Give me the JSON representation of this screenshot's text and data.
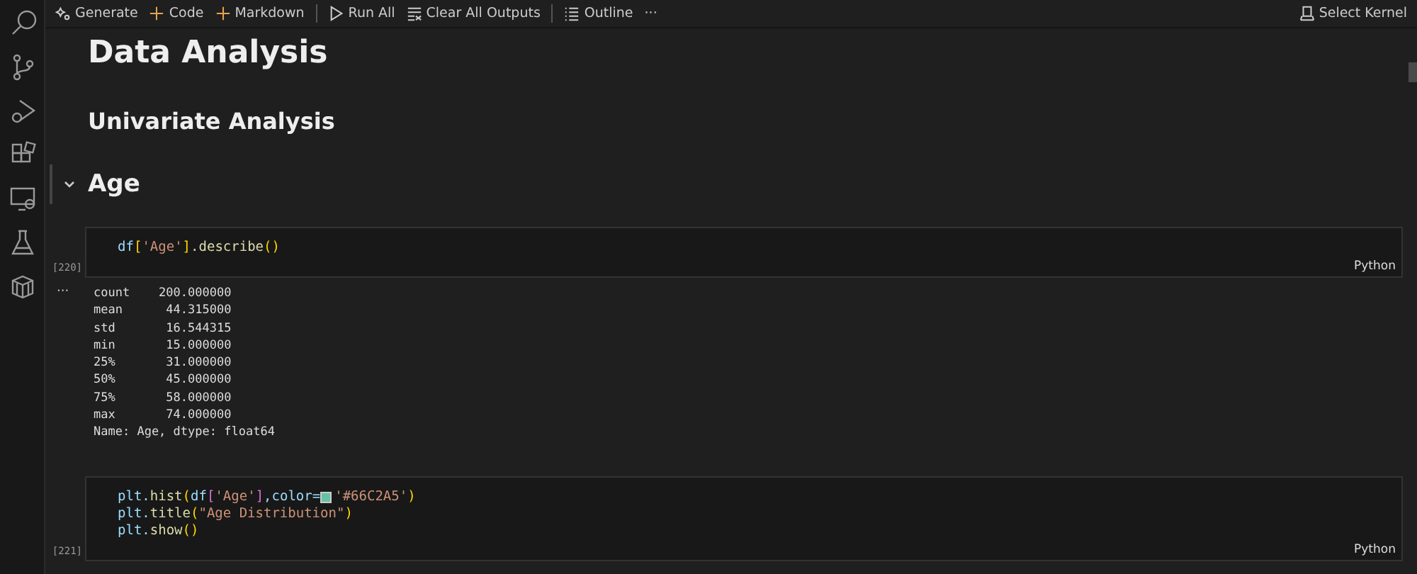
{
  "toolbar": {
    "items": [
      {
        "kind": "button",
        "label": "Generate"
      },
      {
        "kind": "button",
        "label": "Code"
      },
      {
        "kind": "button",
        "label": "Markdown"
      },
      {
        "kind": "separator"
      },
      {
        "kind": "button",
        "label": "Run All"
      },
      {
        "kind": "button",
        "label": "Clear All Outputs"
      },
      {
        "kind": "separator"
      },
      {
        "kind": "button",
        "label": "Outline"
      },
      {
        "kind": "more",
        "label": "···"
      }
    ],
    "kernel": "Select Kernel"
  },
  "cells": [
    {
      "kind": "title",
      "text": "Data Analysis",
      "selected": false
    },
    {
      "kind": "subtitle",
      "text": "Univariate Analysis",
      "selected": false
    },
    {
      "kind": "section",
      "text": "Age",
      "selected": true,
      "expanded": true
    },
    {
      "kind": "code",
      "count": "[220]",
      "language": "Python",
      "lines": [
        [
          {
            "kind": "name",
            "text": "df"
          },
          {
            "kind": "bracket1",
            "text": "["
          },
          {
            "kind": "string",
            "text": "'Age'"
          },
          {
            "kind": "bracket1",
            "text": "]"
          },
          {
            "kind": "func",
            "text": ".describe"
          },
          {
            "kind": "bracket1",
            "text": "()"
          }
        ]
      ],
      "output": {
        "more": "···",
        "lines": [
          "count    200.000000",
          "mean      44.315000",
          "std       16.544315",
          "min       15.000000",
          "25%       31.000000",
          "50%       45.000000",
          "75%       58.000000",
          "max       74.000000",
          "Name: Age, dtype: float64"
        ]
      }
    },
    {
      "kind": "code",
      "count": "[221]",
      "language": "Python",
      "lines": [
        [
          {
            "kind": "name",
            "text": "plt."
          },
          {
            "kind": "func",
            "text": "hist"
          },
          {
            "kind": "bracket1",
            "text": "("
          },
          {
            "kind": "name",
            "text": "df"
          },
          {
            "kind": "bracket2",
            "text": "["
          },
          {
            "kind": "string",
            "text": "'Age'"
          },
          {
            "kind": "bracket2",
            "text": "]"
          },
          {
            "kind": "name",
            "text": ",color="
          },
          {
            "kind": "swatch",
            "color": "#66c2a5"
          },
          {
            "kind": "string",
            "text": "'#66C2A5'"
          },
          {
            "kind": "bracket1",
            "text": ")"
          }
        ],
        [
          {
            "kind": "name",
            "text": "plt."
          },
          {
            "kind": "func",
            "text": "title"
          },
          {
            "kind": "bracket1",
            "text": "("
          },
          {
            "kind": "string",
            "text": "\"Age Distribution\""
          },
          {
            "kind": "bracket1",
            "text": ")"
          }
        ],
        [
          {
            "kind": "name",
            "text": "plt."
          },
          {
            "kind": "func",
            "text": "show"
          },
          {
            "kind": "bracket1",
            "text": "()"
          }
        ]
      ]
    }
  ]
}
